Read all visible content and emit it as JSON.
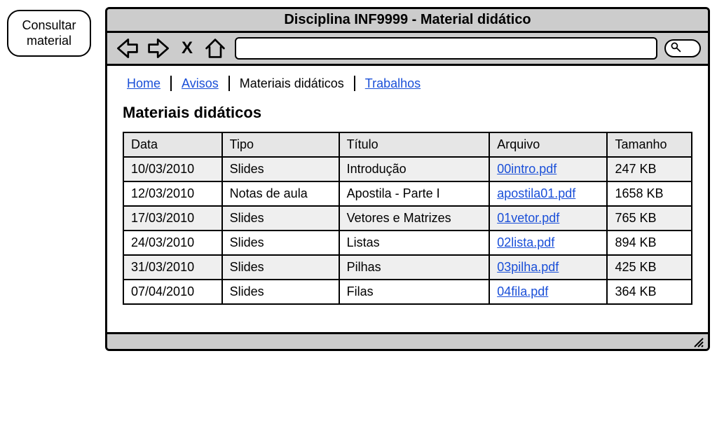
{
  "side_label": {
    "line1": "Consultar",
    "line2": "material"
  },
  "window": {
    "title": "Disciplina INF9999 - Material didático"
  },
  "nav": {
    "items": [
      {
        "label": "Home",
        "current": false
      },
      {
        "label": "Avisos",
        "current": false
      },
      {
        "label": "Materiais didáticos",
        "current": true
      },
      {
        "label": "Trabalhos",
        "current": false
      }
    ]
  },
  "heading": "Materiais didáticos",
  "table": {
    "headers": [
      "Data",
      "Tipo",
      "Título",
      "Arquivo",
      "Tamanho"
    ],
    "rows": [
      {
        "data": "10/03/2010",
        "tipo": "Slides",
        "titulo": "Introdução",
        "arquivo": "00intro.pdf",
        "tamanho": "247 KB"
      },
      {
        "data": "12/03/2010",
        "tipo": "Notas de aula",
        "titulo": "Apostila - Parte I",
        "arquivo": "apostila01.pdf",
        "tamanho": "1658 KB"
      },
      {
        "data": "17/03/2010",
        "tipo": "Slides",
        "titulo": "Vetores e Matrizes",
        "arquivo": "01vetor.pdf",
        "tamanho": "765 KB"
      },
      {
        "data": "24/03/2010",
        "tipo": "Slides",
        "titulo": "Listas",
        "arquivo": "02lista.pdf",
        "tamanho": "894 KB"
      },
      {
        "data": "31/03/2010",
        "tipo": "Slides",
        "titulo": "Pilhas",
        "arquivo": "03pilha.pdf",
        "tamanho": "425 KB"
      },
      {
        "data": "07/04/2010",
        "tipo": "Slides",
        "titulo": "Filas",
        "arquivo": "04fila.pdf",
        "tamanho": "364 KB"
      }
    ]
  }
}
